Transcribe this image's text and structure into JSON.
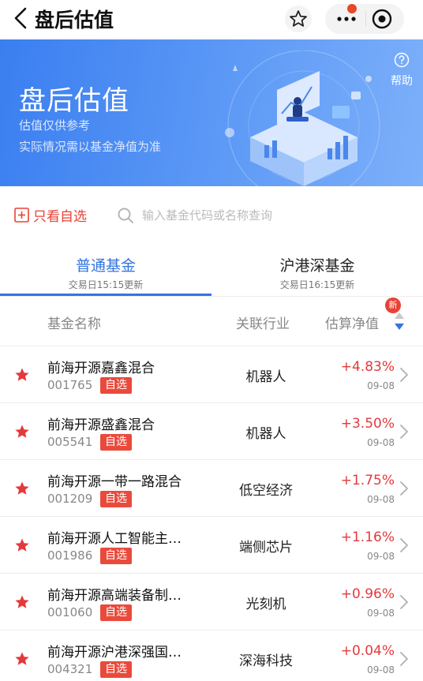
{
  "nav": {
    "title": "盘后估值"
  },
  "banner": {
    "title": "盘后估值",
    "subtitle1": "估值仅供参考",
    "subtitle2": "实际情况需以基金净值为准",
    "help_label": "帮助"
  },
  "filter": {
    "watch_only_label": "只看自选",
    "search_placeholder": "输入基金代码或名称查询"
  },
  "tabs": [
    {
      "label": "普通基金",
      "update": "交易日15:15更新"
    },
    {
      "label": "沪港深基金",
      "update": "交易日16:15更新"
    }
  ],
  "columns": {
    "name": "基金名称",
    "industry": "关联行业",
    "nav": "估算净值",
    "new_badge": "新"
  },
  "funds": [
    {
      "name": "前海开源嘉鑫混合",
      "code": "001765",
      "tag": "自选",
      "industry": "机器人",
      "change": "+4.83%",
      "date": "09-08"
    },
    {
      "name": "前海开源盛鑫混合",
      "code": "005541",
      "tag": "自选",
      "industry": "机器人",
      "change": "+3.50%",
      "date": "09-08"
    },
    {
      "name": "前海开源一带一路混合",
      "code": "001209",
      "tag": "自选",
      "industry": "低空经济",
      "change": "+1.75%",
      "date": "09-08"
    },
    {
      "name": "前海开源人工智能主…",
      "code": "001986",
      "tag": "自选",
      "industry": "端侧芯片",
      "change": "+1.16%",
      "date": "09-08"
    },
    {
      "name": "前海开源高端装备制…",
      "code": "001060",
      "tag": "自选",
      "industry": "光刻机",
      "change": "+0.96%",
      "date": "09-08"
    },
    {
      "name": "前海开源沪港深强国…",
      "code": "004321",
      "tag": "自选",
      "industry": "深海科技",
      "change": "+0.04%",
      "date": "09-08"
    }
  ],
  "colors": {
    "accent": "#3474e0",
    "up": "#e4393c",
    "tag": "#ea4a3c"
  }
}
